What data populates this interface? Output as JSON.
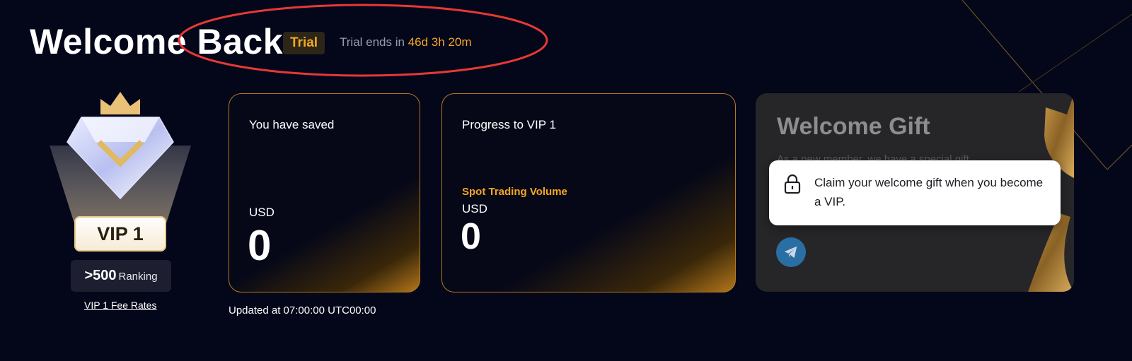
{
  "header": {
    "title": "Welcome Back",
    "trial_badge": "Trial",
    "trial_prefix": "Trial ends in",
    "trial_remaining": "46d 3h 20m"
  },
  "vip": {
    "level_label": "VIP 1",
    "ranking_value": ">500",
    "ranking_label": "Ranking",
    "fee_link": "VIP 1 Fee Rates"
  },
  "savings_card": {
    "label": "You have saved",
    "unit": "USD",
    "value": "0"
  },
  "progress_card": {
    "label": "Progress to VIP 1",
    "metric_label": "Spot Trading Volume",
    "unit": "USD",
    "value": "0"
  },
  "updated_text": "Updated at 07:00:00 UTC00:00",
  "gift_card": {
    "title": "Welcome Gift",
    "subtitle": "As a new member, we have a special gift",
    "tooltip": "Claim your welcome gift when you become a VIP."
  },
  "icons": {
    "lock": "lock-icon",
    "telegram": "telegram-icon",
    "crown": "crown-icon",
    "diamond": "diamond-icon"
  },
  "colors": {
    "background": "#04061a",
    "accent_gold": "#f5a623",
    "card_border": "#b37a1c",
    "annotation_red": "#e53935"
  }
}
